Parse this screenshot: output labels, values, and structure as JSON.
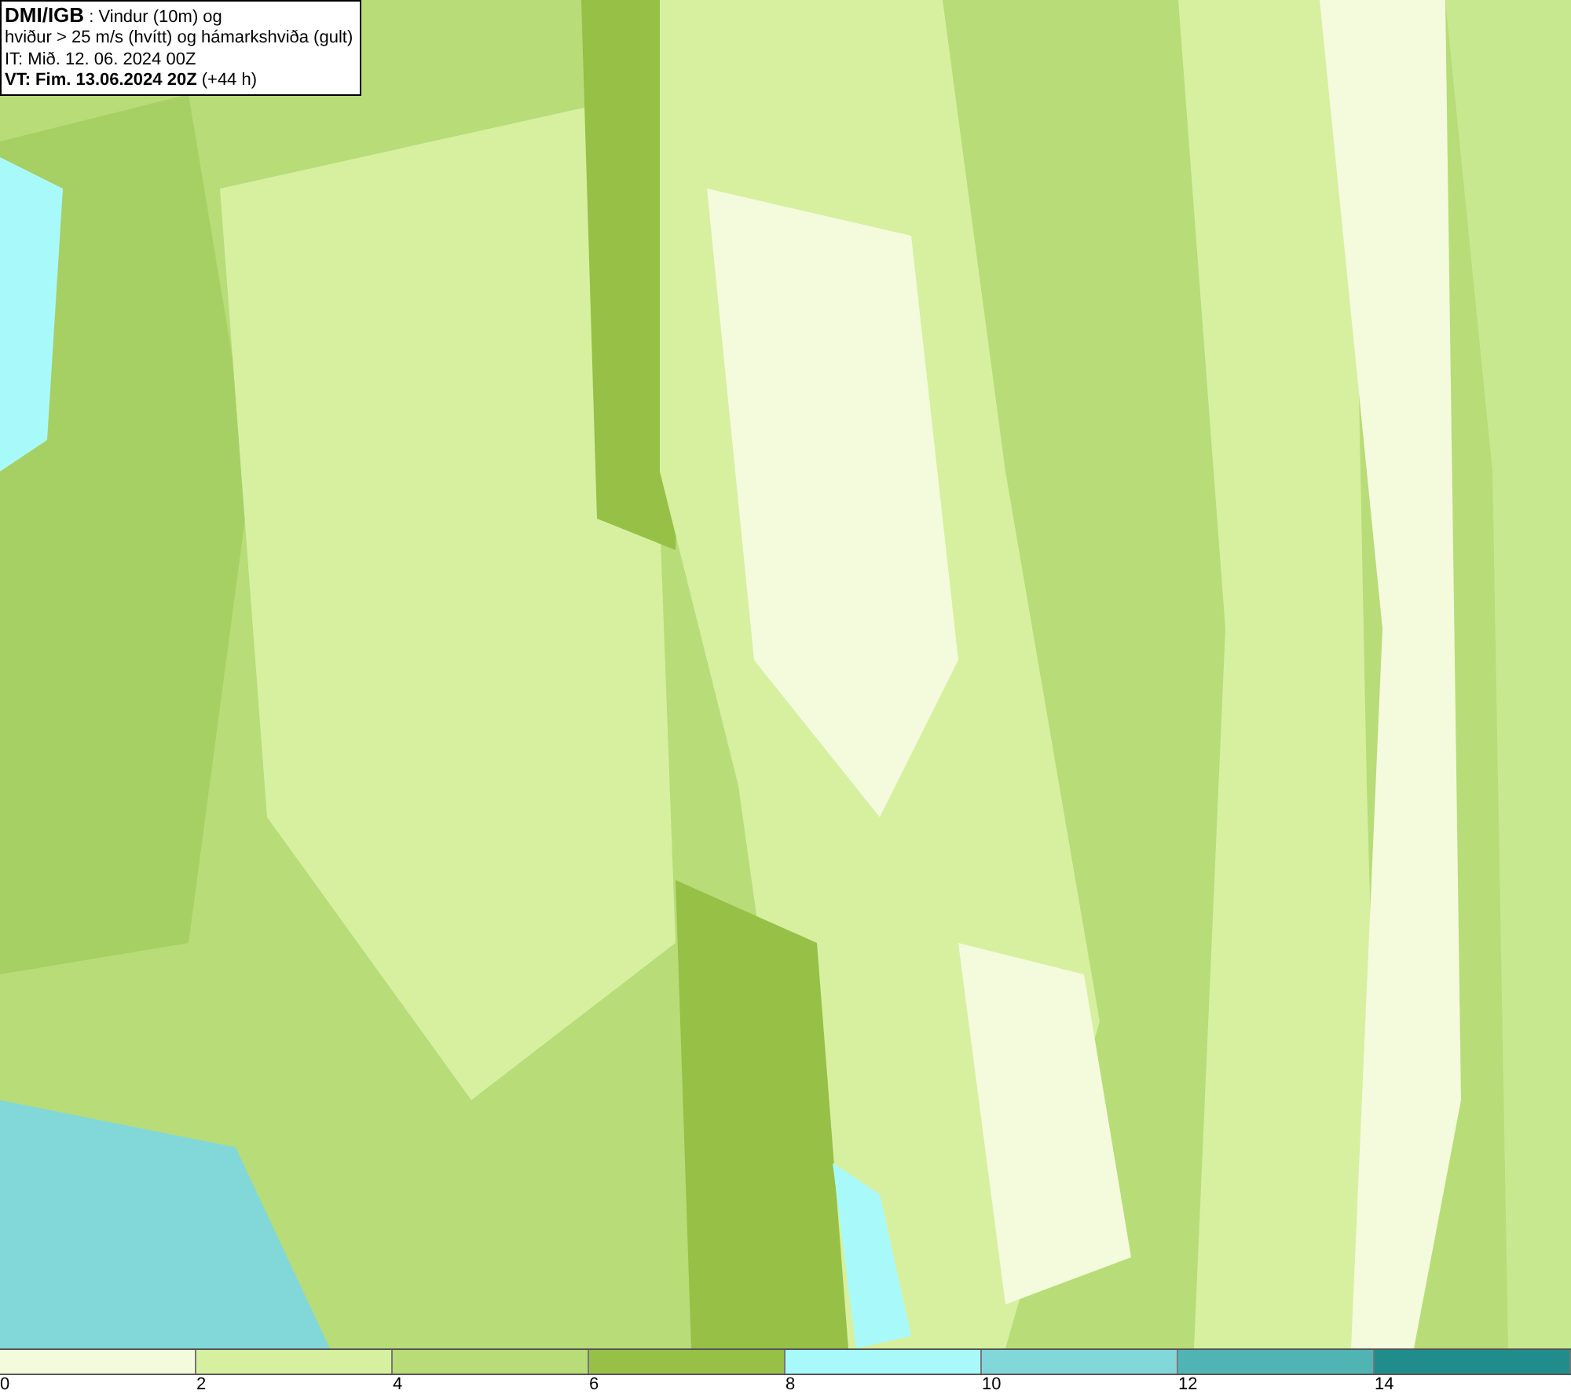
{
  "title_box": {
    "lines": [
      "**DMI/IGB** : Vindur (10m) og",
      "hviður > 25 m/s (hvítt) og hámarkshviða (gult)",
      "IT: Mið. 12. 06. 2024 00Z",
      "**VT: Fim. 13.06.2024 20Z** (+44 h)"
    ]
  },
  "legend": {
    "bins": [
      {
        "color": "#f4fadc"
      },
      {
        "color": "#d6f0a0"
      },
      {
        "color": "#b8dc78"
      },
      {
        "color": "#96c046"
      },
      {
        "color": "#a8fafa"
      },
      {
        "color": "#82d8d8"
      },
      {
        "color": "#50b4b4"
      },
      {
        "color": "#208c8c"
      }
    ],
    "ticks": [
      "0",
      "2",
      "4",
      "6",
      "8",
      "10",
      "12",
      "14"
    ]
  }
}
